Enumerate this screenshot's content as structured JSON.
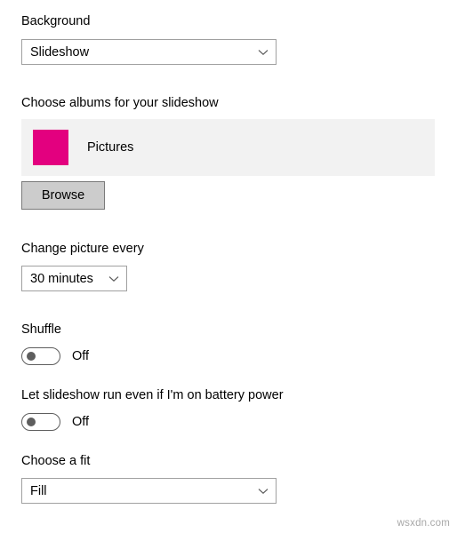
{
  "sections": {
    "background": {
      "label": "Background",
      "select_value": "Slideshow",
      "chevron_icon": "chevron-down-icon"
    },
    "albums": {
      "label": "Choose albums for your slideshow",
      "album_name": "Pictures",
      "album_color": "#e3007f",
      "browse_label": "Browse"
    },
    "change_picture": {
      "label": "Change picture every",
      "select_value": "30 minutes",
      "chevron_icon": "chevron-down-icon"
    },
    "shuffle": {
      "label": "Shuffle",
      "state": "Off"
    },
    "battery": {
      "label": "Let slideshow run even if I'm on battery power",
      "state": "Off"
    },
    "fit": {
      "label": "Choose a fit",
      "select_value": "Fill",
      "chevron_icon": "chevron-down-icon"
    }
  },
  "watermark": "wsxdn.com"
}
